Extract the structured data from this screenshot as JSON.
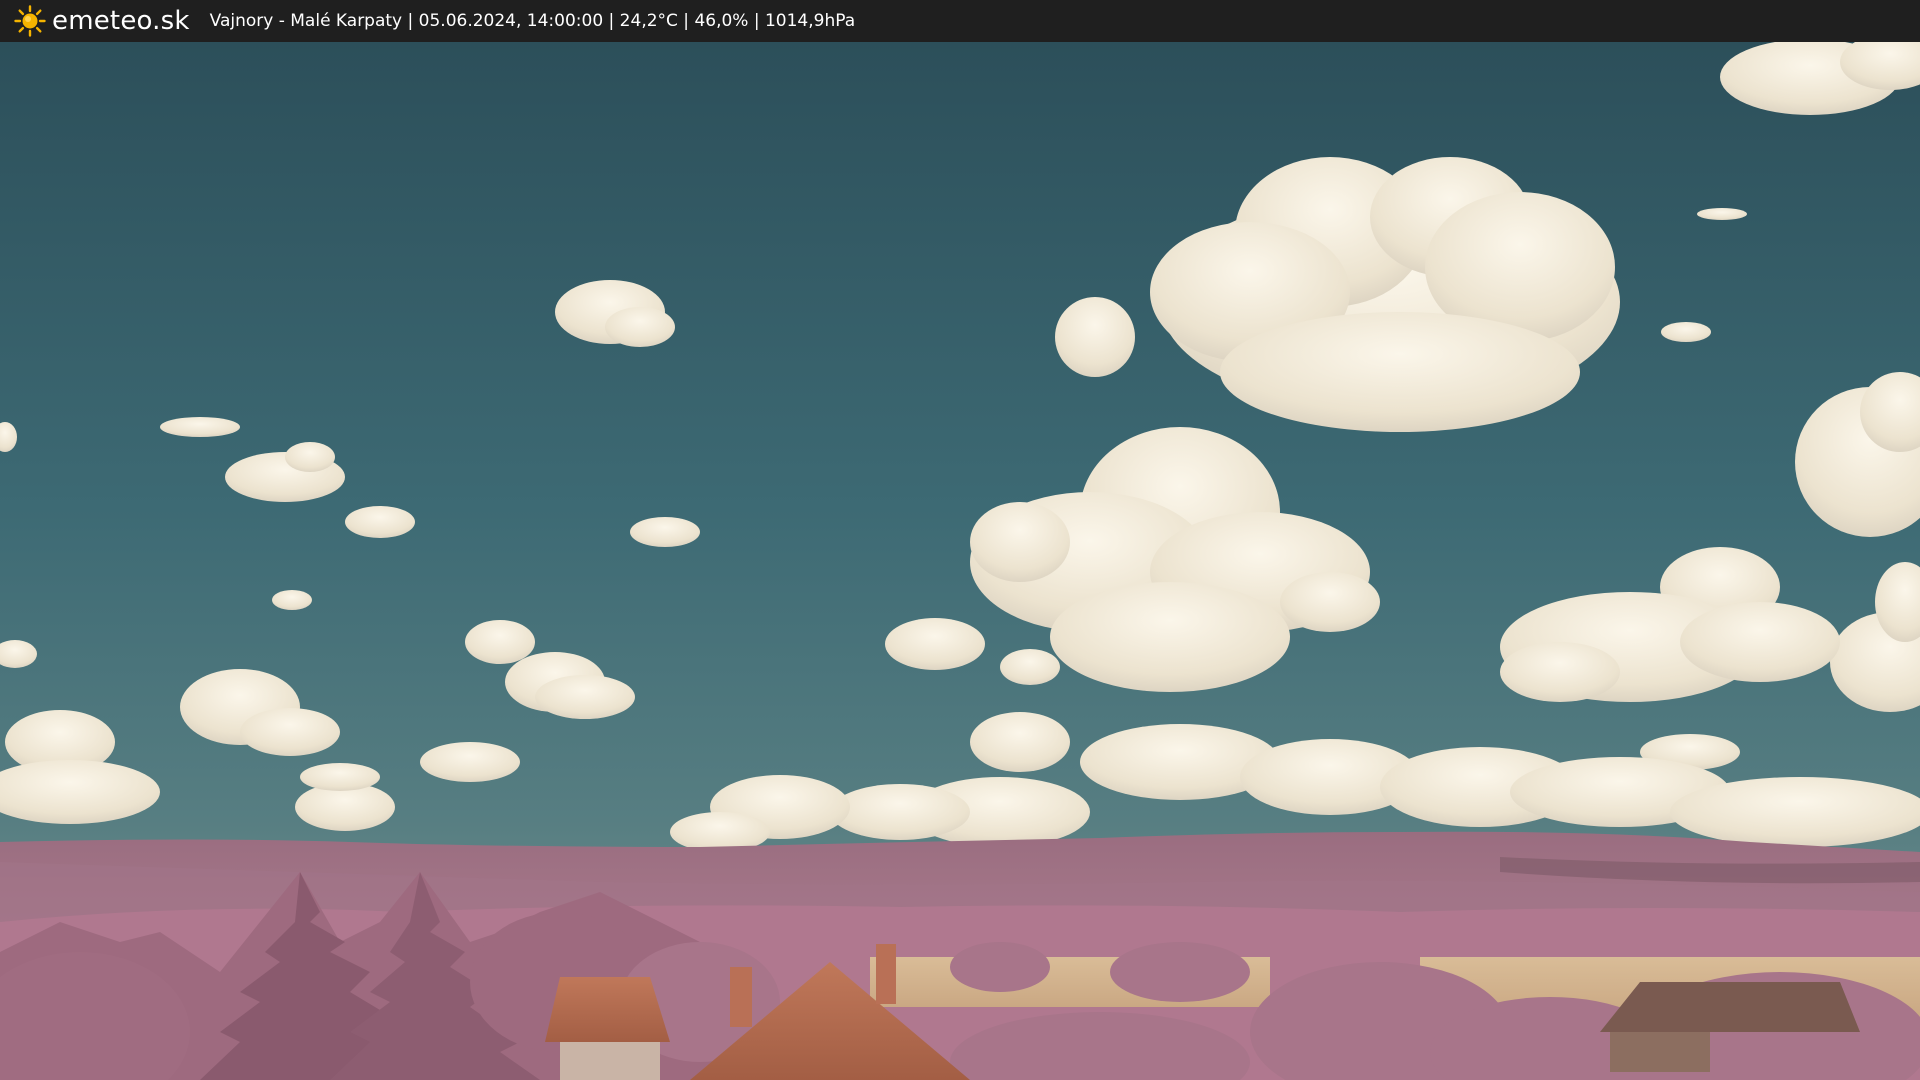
{
  "header": {
    "brand": "emeteo.sk",
    "brand_icon": "sun-icon",
    "caption": "Vajnory - Malé Karpaty | 05.06.2024, 14:00:00 | 24,2°C | 46,0% | 1014,9hPa"
  },
  "colors": {
    "bar_background": "#1f1f1f",
    "sun": "#f5b400",
    "sky_top": "#2c4f5a",
    "sky_horizon": "#6e8f8c",
    "cloud": "#f1ead9",
    "foliage": "#b0788f",
    "field": "#d8b58c",
    "roof": "#c7704a"
  },
  "webcam_image": {
    "subject": "infrared webcam view of sky with cumulus clouds over pink-toned hills, trees, fields and rooftops"
  }
}
